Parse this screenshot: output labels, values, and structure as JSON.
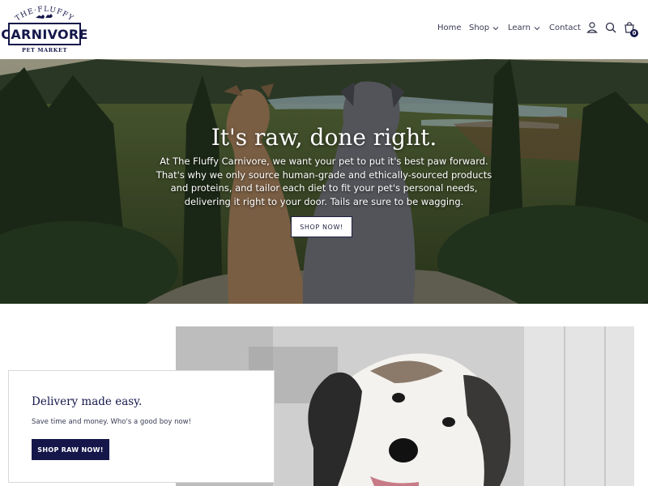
{
  "brand": {
    "arc_text": "THE·FLUFFY",
    "name": "CARNIVORE",
    "tagline": "PET MARKET",
    "color": "#15174a"
  },
  "nav": {
    "items": [
      {
        "label": "Home",
        "has_dropdown": false
      },
      {
        "label": "Shop",
        "has_dropdown": true
      },
      {
        "label": "Learn",
        "has_dropdown": true
      },
      {
        "label": "Contact",
        "has_dropdown": false
      }
    ],
    "icons": [
      "account-icon",
      "search-icon",
      "cart-icon"
    ],
    "cart_count": "0"
  },
  "hero": {
    "title": "It's raw, done right.",
    "body": "At The Fluffy Carnivore, we want your pet to put it's best paw forward. That's why we only source human-grade and ethically-sourced products and proteins, and tailor each diet to fit your pet's personal needs, delivering it right to your door. Tails are sure to be wagging.",
    "cta_label": "SHOP NOW!"
  },
  "promo": {
    "title": "Delivery made easy.",
    "subtitle": "Save time and money. Who's a good boy now!",
    "cta_label": "SHOP RAW NOW!"
  },
  "colors": {
    "primary": "#15174a",
    "text": "#3a3c55",
    "white": "#ffffff"
  }
}
